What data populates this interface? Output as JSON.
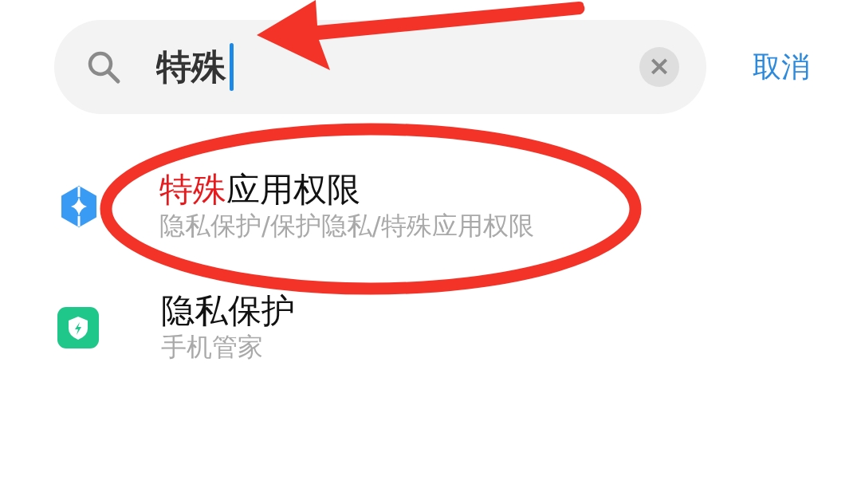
{
  "search": {
    "value": "特殊",
    "clear_button": "×",
    "cancel": "取消"
  },
  "results": [
    {
      "title_match": "特殊",
      "title_rest": "应用权限",
      "subtitle": "隐私保护/保护隐私/特殊应用权限"
    },
    {
      "title_rest": "隐私保护",
      "subtitle": "手机管家"
    }
  ]
}
